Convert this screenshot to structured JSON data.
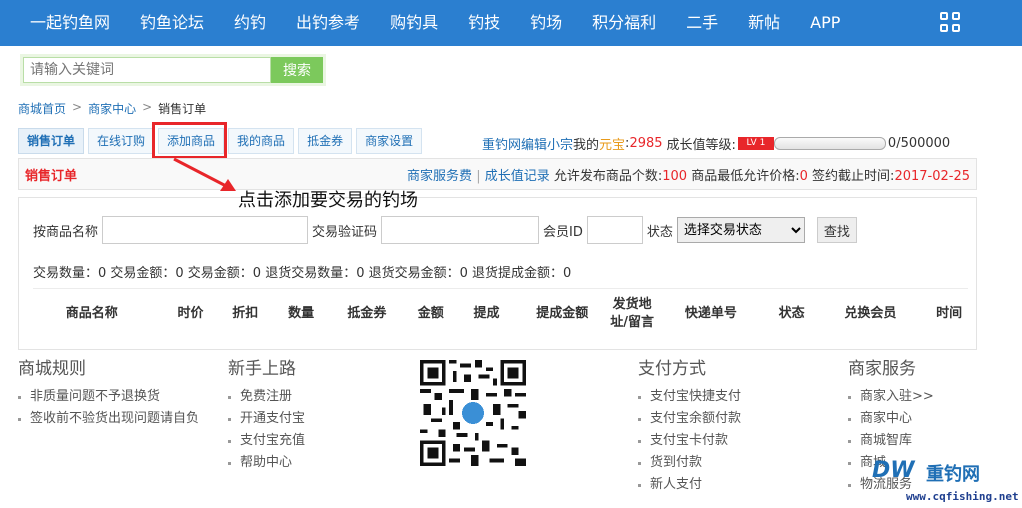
{
  "topnav": {
    "items": [
      "一起钓鱼网",
      "钓鱼论坛",
      "约钓",
      "出钓参考",
      "购钓具",
      "钓技",
      "钓场",
      "积分福利",
      "二手",
      "新帖",
      "APP"
    ]
  },
  "search": {
    "placeholder": "请输入关键词",
    "button": "搜索"
  },
  "breadcrumb": {
    "home": "商城首页",
    "seller_center": "商家中心",
    "current": "销售订单",
    "sep": ">"
  },
  "tabs": [
    "销售订单",
    "在线订购",
    "添加商品",
    "我的商品",
    "抵金券",
    "商家设置"
  ],
  "userinfo": {
    "username": "重钓网编辑小宗",
    "my_label": "我的",
    "yuanbao_label": "元宝",
    "yuanbao_sep": ":",
    "yuanbao_value": "2985",
    "growth_label": "成长值等级:",
    "level_badge": "LV 1",
    "progress_text": "0/500000",
    "progress_fraction": 0
  },
  "panel": {
    "title": "销售订单",
    "service_fee_link": "商家服务费",
    "divider": "|",
    "growth_record_link": "成长值记录",
    "allow_count_label": "允许发布商品个数:",
    "allow_count_value": "100",
    "min_price_label": "商品最低允许价格:",
    "min_price_value": "0",
    "deadline_label": "签约截止时间:",
    "deadline_value": "2017-02-25"
  },
  "annotation": "点击添加要交易的钓场",
  "filter": {
    "product_name_label": "按商品名称",
    "verify_code_label": "交易验证码",
    "member_id_label": "会员ID",
    "status_label": "状态",
    "status_selected": "选择交易状态",
    "search_button": "查找"
  },
  "stats_text": "交易数量：0 交易金额：0 交易金额：0 退货交易数量：0 退货交易金额：0 退货提成金额：0",
  "table_headers": [
    "商品名称",
    "时价",
    "折扣",
    "数量",
    "抵金券",
    "金额",
    "提成",
    "提成金额",
    "发货地址/留言",
    "快递单号",
    "状态",
    "兑换会员",
    "时间"
  ],
  "footer": {
    "mall_rules": {
      "title": "商城规则",
      "items": [
        "非质量问题不予退换货",
        "签收前不验货出现问题请自负"
      ]
    },
    "newbie": {
      "title": "新手上路",
      "items": [
        "免费注册",
        "开通支付宝",
        "支付宝充值",
        "帮助中心"
      ]
    },
    "payment": {
      "title": "支付方式",
      "items": [
        "支付宝快捷支付",
        "支付宝余额付款",
        "支付宝卡付款",
        "货到付款",
        "新人支付"
      ]
    },
    "seller_service": {
      "title": "商家服务",
      "items": [
        "商家入驻>>",
        "商家中心",
        "商城智库",
        "商城",
        "物流服务"
      ]
    }
  },
  "watermark": {
    "logo": "DW",
    "name": "重钓网",
    "url": "www.cqfishing.net"
  },
  "colors": {
    "nav_blue": "#2b7fd0",
    "link_blue": "#1f6fb5",
    "accent_red": "#e8262a",
    "search_green": "#7cc95c"
  }
}
